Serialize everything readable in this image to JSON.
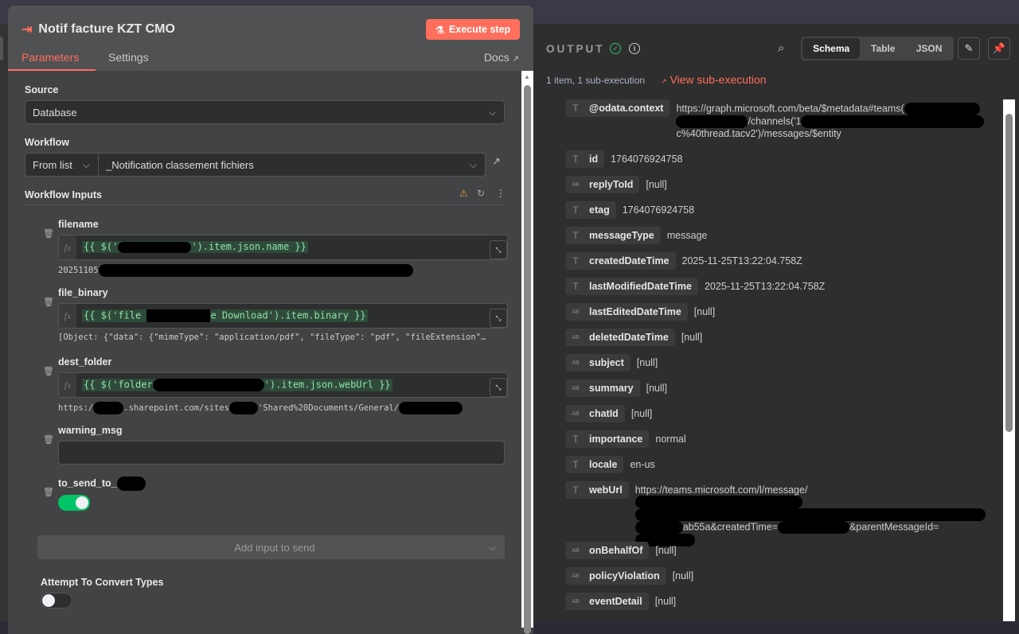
{
  "node": {
    "title": "Notif facture KZT CMO",
    "execute_label": "Execute step",
    "tabs": [
      "Parameters",
      "Settings"
    ],
    "docs_label": "Docs"
  },
  "params": {
    "source_label": "Source",
    "source_value": "Database",
    "workflow_label": "Workflow",
    "workflow_mode": "From list",
    "workflow_value": "_Notification classement fichiers",
    "inputs_label": "Workflow Inputs",
    "fields": [
      {
        "name": "filename",
        "expr_a": "{{ $('",
        "expr_b": "').item.json.name }}",
        "result": "20251105"
      },
      {
        "name": "file_binary",
        "expr_a": "{{ $('file ",
        "expr_b": "e Download').item.binary }}",
        "result": "[Object: {\"data\": {\"mimeType\": \"application/pdf\", \"fileType\": \"pdf\", \"fileExtension\"…"
      },
      {
        "name": "dest_folder",
        "expr_a": "{{ $('folder",
        "expr_b": "').item.json.webUrl }}",
        "result_a": "https:/",
        "result_b": ".sharepoint.com/sites",
        "result_c": "'Shared%20Documents/General/"
      },
      {
        "name": "warning_msg",
        "value": ""
      },
      {
        "name": "to_send_to_",
        "toggle_on": true
      }
    ],
    "add_input_label": "Add input to send",
    "convert_label": "Attempt To Convert Types",
    "convert_on": false
  },
  "output": {
    "title": "OUTPUT",
    "views": [
      "Schema",
      "Table",
      "JSON"
    ],
    "active_view": "Schema",
    "meta": "1 item, 1 sub-execution",
    "sub_link": "View sub-execution",
    "rows": [
      {
        "type": "T",
        "key": "@odata.context",
        "val": "https://graph.microsoft.com/beta/$metadata#teams(",
        "val2": "/channels('1",
        "val3": "c%40thread.tacv2')/messages/$entity"
      },
      {
        "type": "T",
        "key": "id",
        "val": "1764076924758"
      },
      {
        "type": "AB",
        "key": "replyToId",
        "val": "[null]"
      },
      {
        "type": "T",
        "key": "etag",
        "val": "1764076924758"
      },
      {
        "type": "T",
        "key": "messageType",
        "val": "message"
      },
      {
        "type": "T",
        "key": "createdDateTime",
        "val": "2025-11-25T13:22:04.758Z"
      },
      {
        "type": "T",
        "key": "lastModifiedDateTime",
        "val": "2025-11-25T13:22:04.758Z"
      },
      {
        "type": "AB",
        "key": "lastEditedDateTime",
        "val": "[null]"
      },
      {
        "type": "AB",
        "key": "deletedDateTime",
        "val": "[null]"
      },
      {
        "type": "AB",
        "key": "subject",
        "val": "[null]"
      },
      {
        "type": "AB",
        "key": "summary",
        "val": "[null]"
      },
      {
        "type": "AB",
        "key": "chatId",
        "val": "[null]"
      },
      {
        "type": "T",
        "key": "importance",
        "val": "normal"
      },
      {
        "type": "T",
        "key": "locale",
        "val": "en-us"
      },
      {
        "type": "T",
        "key": "webUrl",
        "val": "https://teams.microsoft.com/l/message/",
        "val2": "ab55a&createdTime=",
        "val3": "&parentMessageId="
      },
      {
        "type": "AB",
        "key": "onBehalfOf",
        "val": "[null]"
      },
      {
        "type": "AB",
        "key": "policyViolation",
        "val": "[null]"
      },
      {
        "type": "AB",
        "key": "eventDetail",
        "val": "[null]"
      }
    ]
  },
  "colors": {
    "accent": "#ff6f5c",
    "success": "#2fbf71",
    "toggle_on": "#00c466"
  }
}
